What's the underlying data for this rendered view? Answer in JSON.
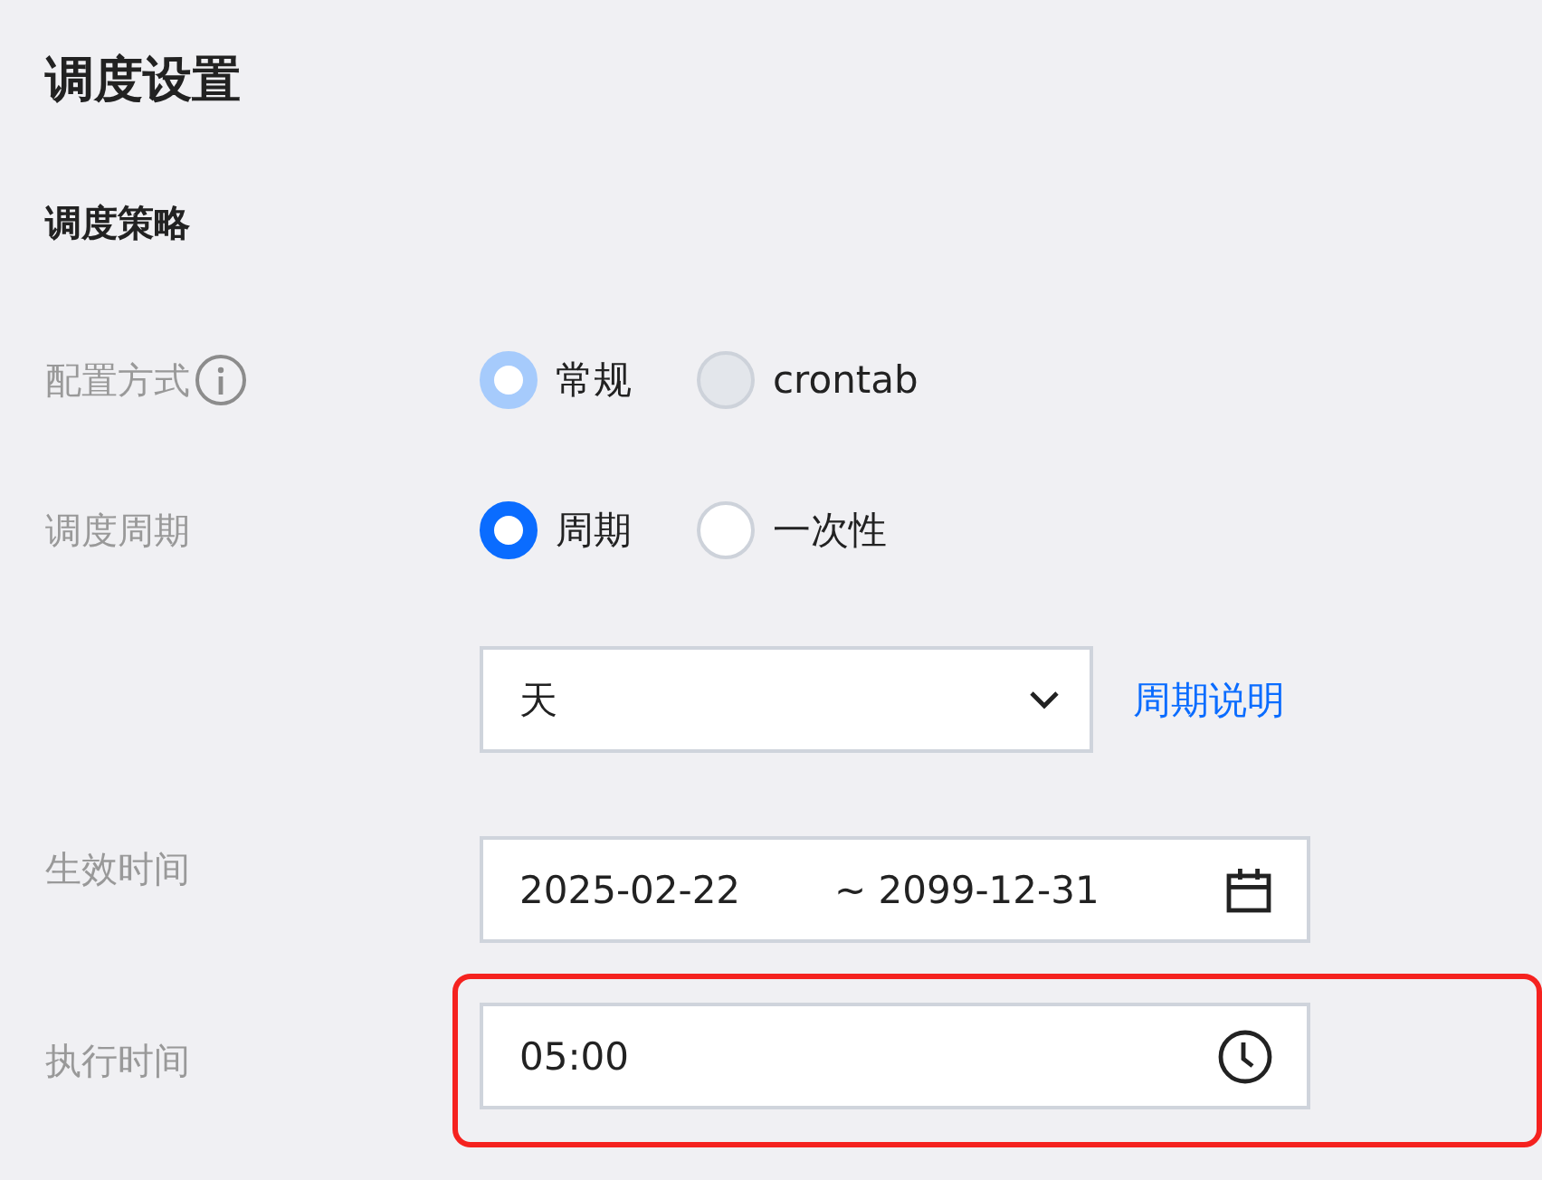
{
  "title": "调度设置",
  "section": "调度策略",
  "config_mode": {
    "label": "配置方式",
    "has_info": true,
    "options": [
      {
        "label": "常规",
        "selected": true,
        "disabled": true
      },
      {
        "label": "crontab",
        "selected": false,
        "disabled": true
      }
    ]
  },
  "schedule_cycle": {
    "label": "调度周期",
    "options": [
      {
        "label": "周期",
        "selected": true,
        "disabled": false
      },
      {
        "label": "一次性",
        "selected": false,
        "disabled": false
      }
    ]
  },
  "fields": [
    {
      "kind": "select",
      "value": "天",
      "link": "周期说明",
      "highlighted": false
    },
    {
      "kind": "date-range",
      "label": "生效时间",
      "start": "2025-02-22",
      "end": "~ 2099-12-31",
      "highlighted": false
    },
    {
      "kind": "time",
      "label": "执行时间",
      "value": "05:00",
      "highlighted": true
    }
  ]
}
